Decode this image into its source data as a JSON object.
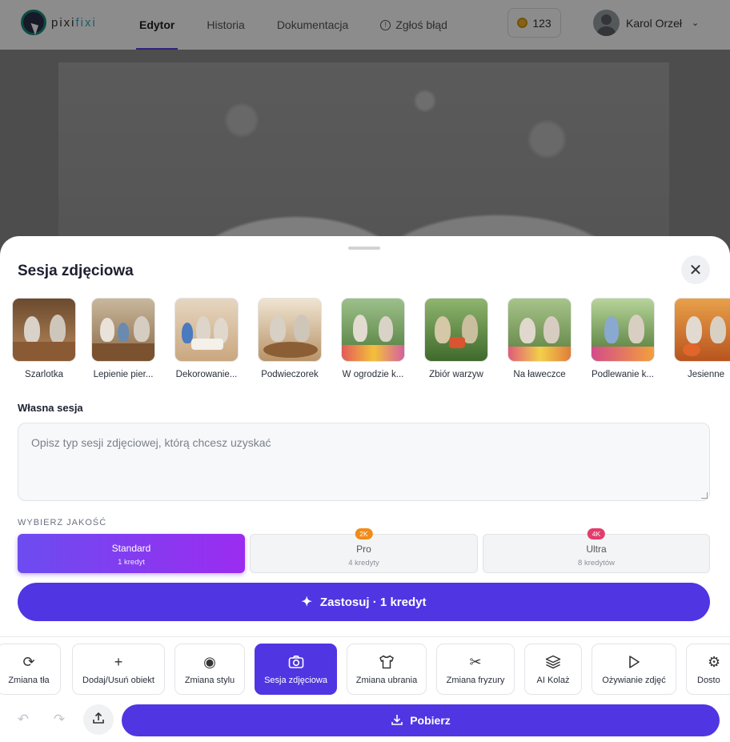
{
  "app": {
    "logo_text_a": "pixi",
    "logo_text_b": "fixi"
  },
  "nav": {
    "items": [
      {
        "label": "Edytor",
        "active": true
      },
      {
        "label": "Historia",
        "active": false
      },
      {
        "label": "Dokumentacja",
        "active": false
      }
    ],
    "report_label": "Zgłoś błąd",
    "credits": "123",
    "user_name": "Karol Orzeł"
  },
  "sheet": {
    "title": "Sesja zdjęciowa",
    "presets": [
      {
        "label": "Szarlotka"
      },
      {
        "label": "Lepienie pier..."
      },
      {
        "label": "Dekorowanie..."
      },
      {
        "label": "Podwieczorek"
      },
      {
        "label": "W ogrodzie k..."
      },
      {
        "label": "Zbiór warzyw"
      },
      {
        "label": "Na ławeczce"
      },
      {
        "label": "Podlewanie k..."
      },
      {
        "label": "Jesienne"
      }
    ],
    "custom_label": "Własna sesja",
    "custom_placeholder": "Opisz typ sesji zdjęciowej, którą chcesz uzyskać",
    "custom_value": "",
    "quality_label": "WYBIERZ JAKOŚĆ",
    "quality": [
      {
        "name": "Standard",
        "cost": "1 kredyt",
        "badge": "",
        "selected": true
      },
      {
        "name": "Pro",
        "cost": "4 kredyty",
        "badge": "2K",
        "selected": false
      },
      {
        "name": "Ultra",
        "cost": "8 kredytów",
        "badge": "4K",
        "selected": false
      }
    ],
    "apply_label": "Zastosuj · 1 kredyt"
  },
  "tools": [
    {
      "label": "Zmiana tła",
      "icon": "refresh-icon",
      "active": false
    },
    {
      "label": "Dodaj/Usuń obiekt",
      "icon": "plus-icon",
      "active": false
    },
    {
      "label": "Zmiana stylu",
      "icon": "palette-icon",
      "active": false
    },
    {
      "label": "Sesja zdjęciowa",
      "icon": "camera-icon",
      "active": true
    },
    {
      "label": "Zmiana ubrania",
      "icon": "shirt-icon",
      "active": false
    },
    {
      "label": "Zmiana fryzury",
      "icon": "scissors-icon",
      "active": false
    },
    {
      "label": "AI Kolaż",
      "icon": "layers-icon",
      "active": false
    },
    {
      "label": "Ożywianie zdjęć",
      "icon": "play-icon",
      "active": false
    },
    {
      "label": "Dosto",
      "icon": "gear-icon",
      "active": false
    }
  ],
  "bottom": {
    "download_label": "Pobierz"
  },
  "colors": {
    "accent": "#5035e2",
    "accent_gradient_end": "#9b2cf0",
    "badge_2k": "#f08c1a",
    "badge_4k": "#e33d6b"
  }
}
